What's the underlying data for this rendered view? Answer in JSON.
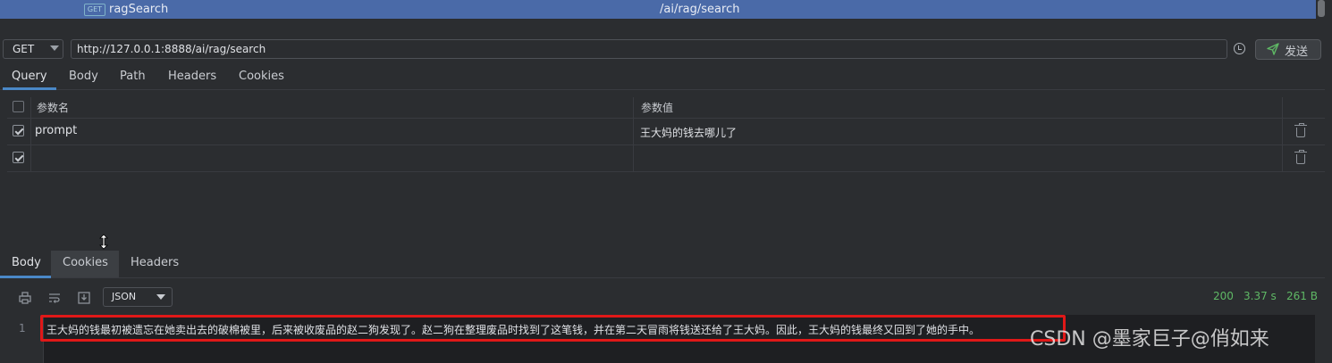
{
  "endpoint": {
    "icon_text": "GET",
    "name": "ragSearch",
    "path": "/ai/rag/search"
  },
  "request": {
    "method": "GET",
    "url": "http://127.0.0.1:8888/ai/rag/search",
    "send_label": "发送",
    "tabs": [
      "Query",
      "Body",
      "Path",
      "Headers",
      "Cookies"
    ],
    "active_tab": "Query"
  },
  "params": {
    "header_name": "参数名",
    "header_value": "参数值",
    "rows": [
      {
        "checked": true,
        "name": "prompt",
        "value": "王大妈的钱去哪儿了"
      },
      {
        "checked": true,
        "name": "",
        "value": ""
      }
    ]
  },
  "response": {
    "tabs": [
      "Body",
      "Cookies",
      "Headers"
    ],
    "active_tab": "Body",
    "format": "JSON",
    "status_code": "200",
    "time": "3.37 s",
    "size": "261 B",
    "line_number": "1",
    "body": "王大妈的钱最初被遗忘在她卖出去的破棉被里，后来被收废品的赵二狗发现了。赵二狗在整理废品时找到了这笔钱，并在第二天冒雨将钱送还给了王大妈。因此，王大妈的钱最终又回到了她的手中。"
  },
  "watermark": "CSDN @墨家巨子@俏如来",
  "colors": {
    "accent": "#4a88c7",
    "selection": "#4a6aa8",
    "status_ok": "#5fb865",
    "highlight": "#e01818"
  }
}
